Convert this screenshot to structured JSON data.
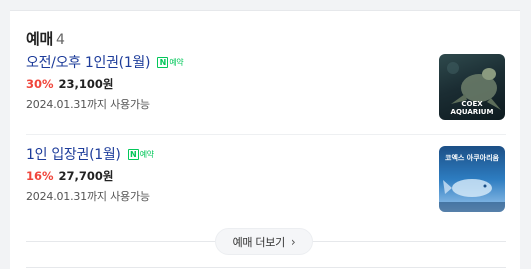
{
  "section": {
    "title": "예매",
    "count": "4"
  },
  "items": [
    {
      "title": "오전/오후 1인권(1월)",
      "npay_icon": "N",
      "npay_text": "예약",
      "discount": "30%",
      "price": "23,100원",
      "valid": "2024.01.31까지 사용가능",
      "thumb_text": "COEX AQUARIUM"
    },
    {
      "title": "1인 입장권(1월)",
      "npay_icon": "N",
      "npay_text": "예약",
      "discount": "16%",
      "price": "27,700원",
      "valid": "2024.01.31까지 사용가능",
      "thumb_text": "코엑스 아쿠아리움"
    }
  ],
  "more_button": {
    "label": "예매 더보기",
    "chevron": "›"
  }
}
